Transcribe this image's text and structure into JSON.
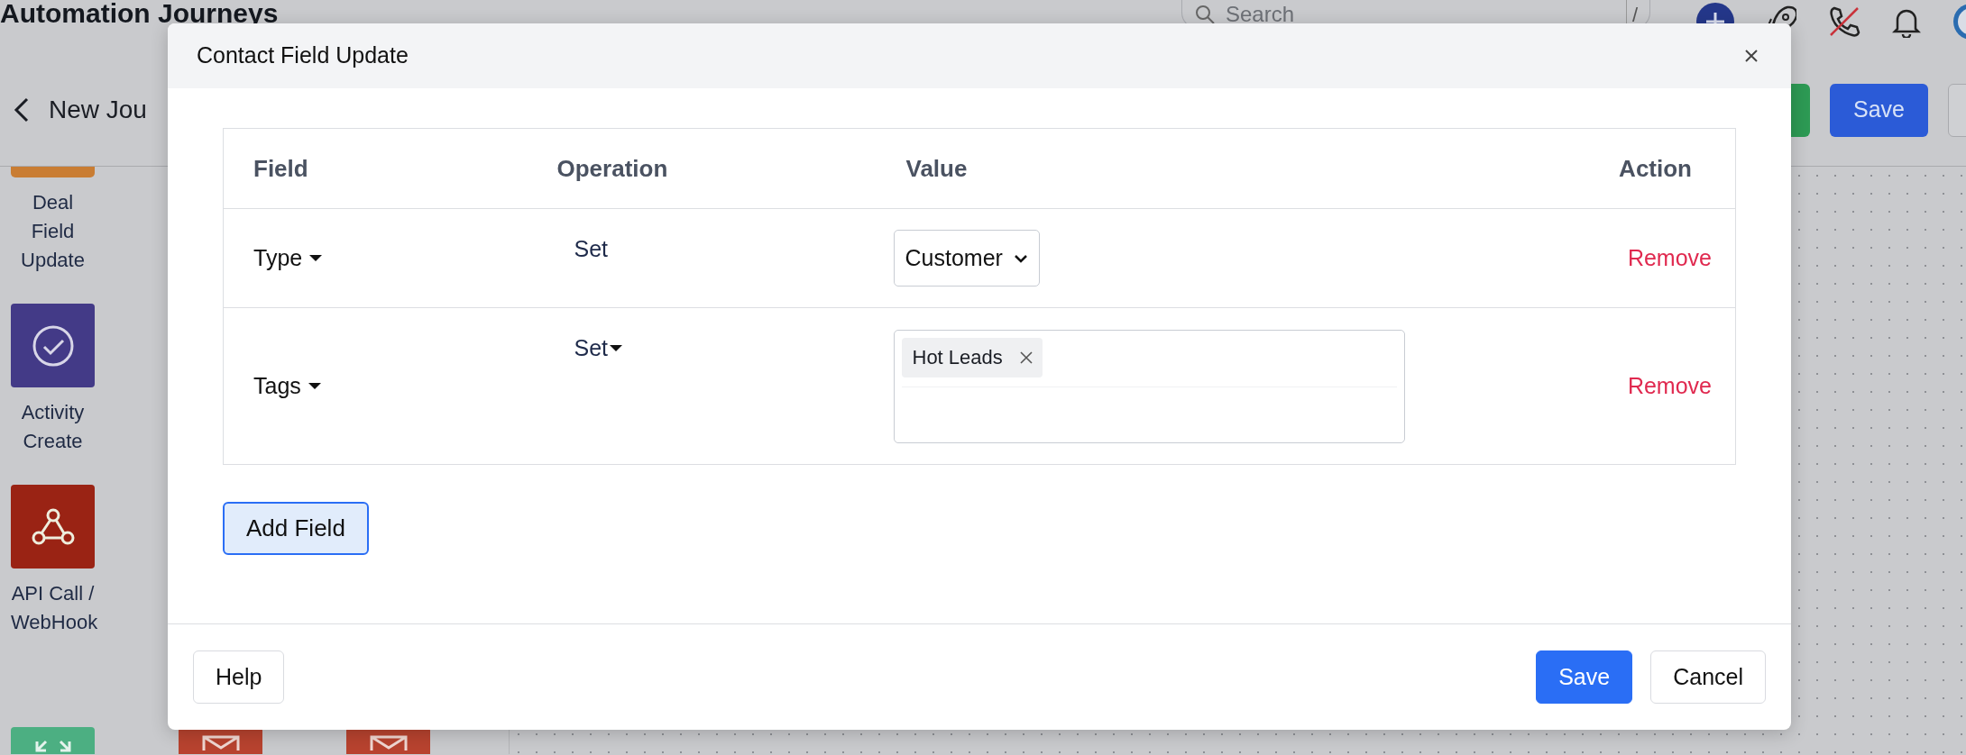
{
  "app_header": {
    "title": "Automation Journeys",
    "search": {
      "placeholder": "Search",
      "shortcut": "/"
    }
  },
  "toolbar": {
    "journey_name": "New Jou",
    "buttons": [
      {
        "kind": "success"
      },
      {
        "kind": "primary",
        "label": "Save"
      },
      {
        "kind": "outline"
      }
    ]
  },
  "sidebar": {
    "items": [
      {
        "label": "Deal Field Update",
        "color": "#c97d33",
        "kind": "clipped"
      },
      {
        "label": "Activity Create",
        "color": "#433a87",
        "kind": "check-circle"
      },
      {
        "label": "API Call / WebHook",
        "color": "#9a2314",
        "kind": "webhook"
      }
    ],
    "bottom_tiles": [
      {
        "color": "#4caf82",
        "kind": "expand"
      },
      {
        "color": "#b8432f",
        "kind": "mail"
      },
      {
        "color": "#b8432f",
        "kind": "mail"
      }
    ]
  },
  "modal": {
    "title": "Contact Field Update",
    "table": {
      "columns": [
        "Field",
        "Operation",
        "Value",
        "Action"
      ],
      "rows": [
        {
          "field": "Type",
          "operation": {
            "label": "Set",
            "kind": "text"
          },
          "value": {
            "kind": "select",
            "text": "Customer"
          },
          "action": "Remove"
        },
        {
          "field": "Tags",
          "operation": {
            "label": "Set",
            "kind": "dropdown"
          },
          "value": {
            "kind": "tags",
            "tags": [
              "Hot Leads"
            ]
          },
          "action": "Remove"
        }
      ]
    },
    "add_button": "Add Field",
    "footer": {
      "help": "Help",
      "save": "Save",
      "cancel": "Cancel"
    }
  }
}
